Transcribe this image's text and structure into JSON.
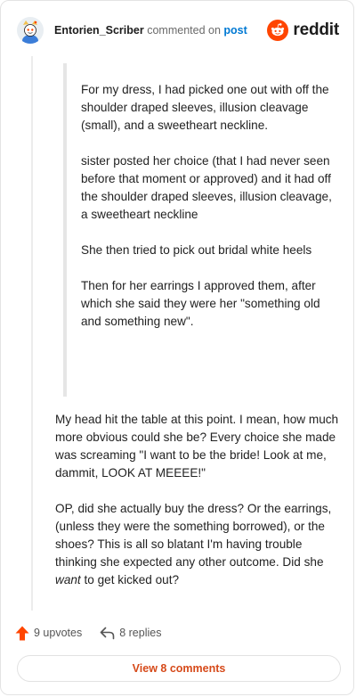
{
  "header": {
    "username": "Entorien_Scriber",
    "commented_on": "commented on",
    "post_link": "post",
    "brand": "reddit"
  },
  "quote": {
    "paragraphs": [
      "For my dress, I had picked one out with off the shoulder draped sleeves, illusion cleavage (small), and a sweetheart neckline.",
      "sister posted her choice (that I had never seen before that moment or approved) and it had off the shoulder draped sleeves, illusion cleavage, a sweetheart neckline",
      "She then tried to pick out bridal white heels",
      "Then for her earrings I approved them, after which she said they were her \"something old and something new\"."
    ]
  },
  "comment": {
    "p1": "My head hit the table at this point. I mean, how much more obvious could she be? Every choice she made was screaming \"I want to be the bride! Look at me, dammit, LOOK AT MEEEE!\"",
    "p2_before": "OP, did she actually buy the dress? Or the earrings, (unless they were the something borrowed), or the shoes? This is all so blatant I'm having trouble thinking she expected any other outcome. Did she ",
    "p2_em": "want",
    "p2_after": " to get kicked out?"
  },
  "actions": {
    "upvotes": "9 upvotes",
    "replies": "8 replies"
  },
  "view_comments": "View 8 comments",
  "colors": {
    "reddit_orange": "#ff4500",
    "link_blue": "#0079d3",
    "view_text": "#d64a1a"
  }
}
